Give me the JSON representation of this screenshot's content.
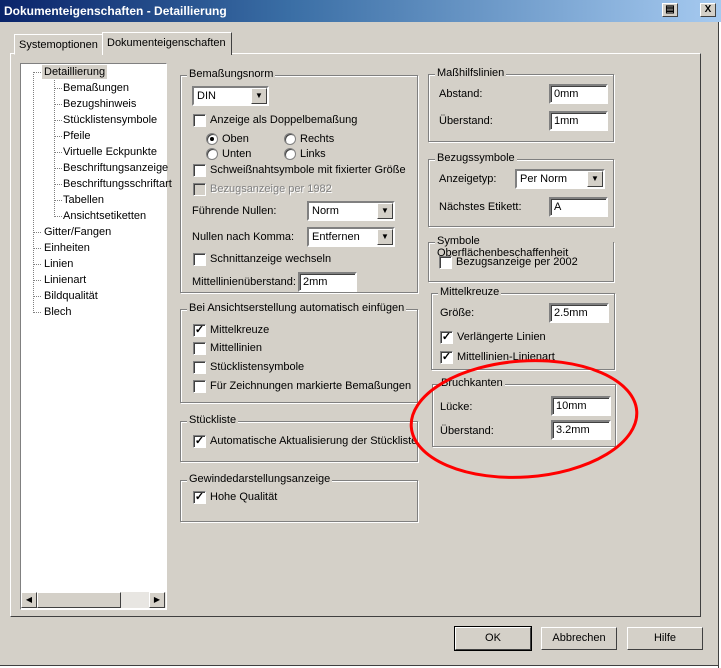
{
  "window": {
    "title": "Dokumenteigenschaften - Detaillierung",
    "print_icon": "printer-icon",
    "close_label": "X"
  },
  "tabs": [
    {
      "label": "Systemoptionen"
    },
    {
      "label": "Dokumenteigenschaften",
      "active": true
    }
  ],
  "tree": {
    "selected": "Detaillierung",
    "root": "Detaillierung",
    "children": [
      "Bemaßungen",
      "Bezugshinweis",
      "Stücklistensymbole",
      "Pfeile",
      "Virtuelle Eckpunkte",
      "Beschriftungsanzeige",
      "Beschriftungsschriftart",
      "Tabellen",
      "Ansichtsetiketten"
    ],
    "others": [
      "Gitter/Fangen",
      "Einheiten",
      "Linien",
      "Linienart",
      "Bildqualität",
      "Blech"
    ]
  },
  "bemassungsnorm": {
    "title": "Bemaßungsnorm",
    "norm": "DIN",
    "doppel": {
      "label": "Anzeige als Doppelbemaßung",
      "checked": false
    },
    "radios": [
      {
        "label": "Oben",
        "checked": true
      },
      {
        "label": "Rechts",
        "checked": false
      },
      {
        "label": "Unten",
        "checked": false
      },
      {
        "label": "Links",
        "checked": false
      }
    ],
    "schweiss": {
      "label": "Schweißnahtsymbole mit fixierter Größe",
      "checked": false
    },
    "bezug1982": {
      "label": "Bezugsanzeige per 1982",
      "checked": false,
      "disabled": true
    },
    "fuehrende_label": "Führende Nullen:",
    "fuehrende_value": "Norm",
    "komma_label": "Nullen nach Komma:",
    "komma_value": "Entfernen",
    "schnitt": {
      "label": "Schnittanzeige wechseln",
      "checked": false
    },
    "mittel_label": "Mittellinienüberstand:",
    "mittel_value": "2mm"
  },
  "ansicht": {
    "title": "Bei Ansichtserstellung automatisch einfügen",
    "items": [
      {
        "label": "Mittelkreuze",
        "checked": true
      },
      {
        "label": "Mittellinien",
        "checked": false
      },
      {
        "label": "Stücklistensymbole",
        "checked": false
      },
      {
        "label": "Für Zeichnungen markierte Bemaßungen",
        "checked": false
      }
    ]
  },
  "stueckliste": {
    "title": "Stückliste",
    "item": {
      "label": "Automatische Aktualisierung der Stückliste",
      "checked": true
    }
  },
  "gewinde": {
    "title": "Gewindedarstellungsanzeige",
    "item": {
      "label": "Hohe Qualität",
      "checked": true
    }
  },
  "masshilfslinien": {
    "title": "Maßhilfslinien",
    "abstand_label": "Abstand:",
    "abstand": "0mm",
    "ueberstand_label": "Überstand:",
    "ueberstand": "1mm"
  },
  "bezugssymbole": {
    "title": "Bezugssymbole",
    "typ_label": "Anzeigetyp:",
    "typ": "Per Norm",
    "etikett_label": "Nächstes Etikett:",
    "etikett": "A"
  },
  "oberflaeche": {
    "title": "Symbole Oberflächenbeschaffenheit",
    "item": {
      "label": "Bezugsanzeige per 2002",
      "checked": false
    }
  },
  "mittelkreuze": {
    "title": "Mittelkreuze",
    "groesse_label": "Größe:",
    "groesse": "2.5mm",
    "items": [
      {
        "label": "Verlängerte Linien",
        "checked": true
      },
      {
        "label": "Mittellinien-Linienart",
        "checked": true
      }
    ]
  },
  "bruchkanten": {
    "title": "Bruchkanten",
    "luecke_label": "Lücke:",
    "luecke": "10mm",
    "ueberstand_label": "Überstand:",
    "ueberstand": "3.2mm"
  },
  "buttons": {
    "ok": "OK",
    "cancel": "Abbrechen",
    "help": "Hilfe"
  },
  "annotation_color": "#ff0000"
}
